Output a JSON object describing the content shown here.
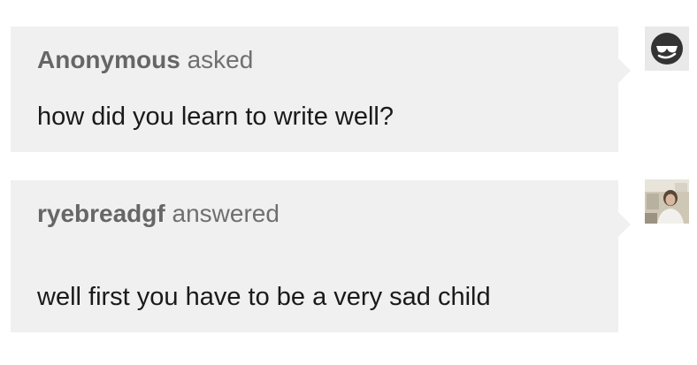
{
  "question": {
    "author": "Anonymous",
    "verb": "asked",
    "text": "how did you learn to write well?"
  },
  "answer": {
    "author": "ryebreadgf",
    "verb": "answered",
    "text": "well first you have to be a very sad child"
  },
  "avatars": {
    "question_icon": "sunglasses-face-icon",
    "answer_icon": "user-photo-avatar"
  },
  "colors": {
    "bubble_bg": "#f0f0f0",
    "page_bg": "#ffffff",
    "meta_text": "#6f6f6f",
    "body_text": "#1a1a1a"
  }
}
